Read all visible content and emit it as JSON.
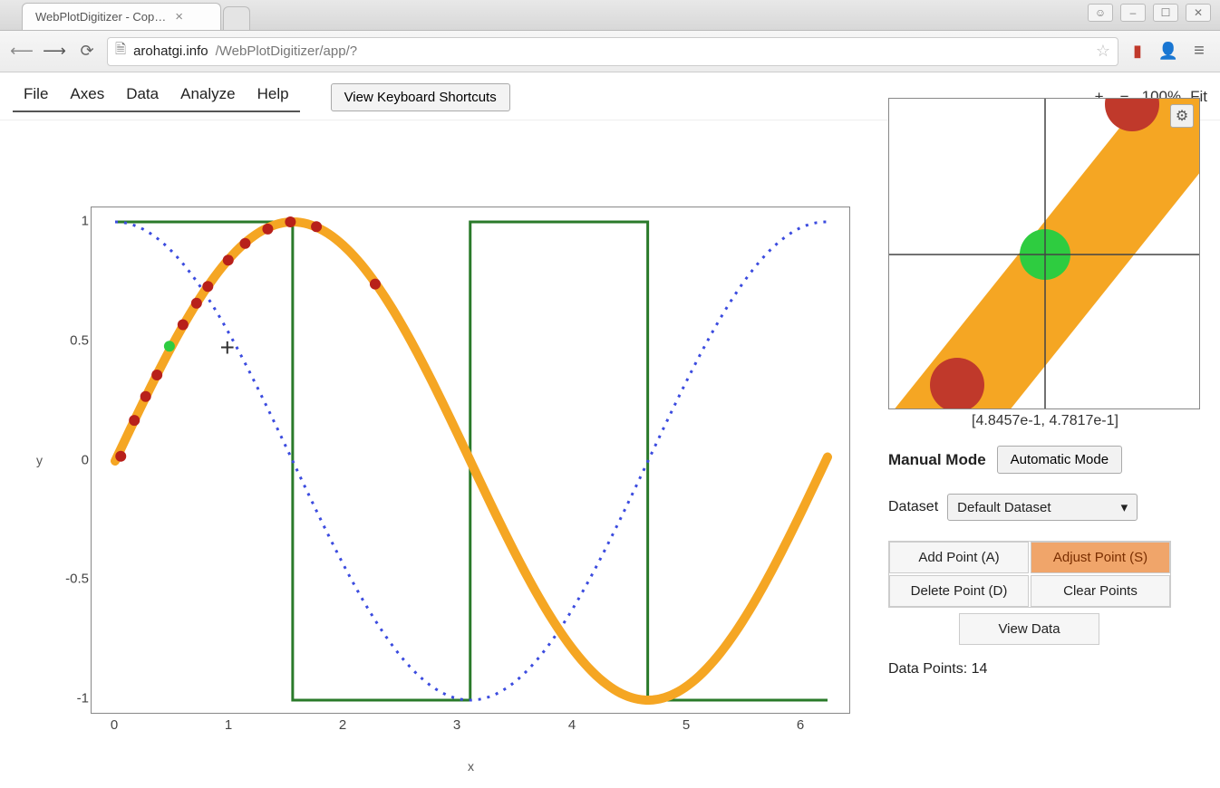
{
  "browser": {
    "tab_title": "WebPlotDigitizer - Cop…",
    "url_host": "arohatgi.info",
    "url_path": "/WebPlotDigitizer/app/?",
    "nav_back_enabled": false,
    "nav_forward_enabled": true
  },
  "menu": {
    "items": [
      "File",
      "Axes",
      "Data",
      "Analyze",
      "Help"
    ],
    "kbd_button": "View Keyboard Shortcuts"
  },
  "zoom": {
    "plus": "+",
    "minus": "−",
    "level": "100%",
    "fit": "Fit"
  },
  "chart_data": {
    "type": "line",
    "xlabel": "x",
    "ylabel": "y",
    "xlim": [
      0,
      6.3
    ],
    "ylim": [
      -1.0,
      1.0
    ],
    "xticks": [
      0,
      1,
      2,
      3,
      4,
      5,
      6
    ],
    "yticks": [
      -1.0,
      -0.5,
      0.0,
      0.5,
      1.0
    ],
    "series": [
      {
        "name": "sine (thick, orange)",
        "x_range": [
          0,
          6.3
        ],
        "fn": "sin(x)",
        "color": "#f5a623"
      },
      {
        "name": "cosine (dotted, blue)",
        "x_range": [
          0,
          6.3
        ],
        "fn": "cos(x)",
        "color": "#3b4bdf"
      },
      {
        "name": "square wave (green)",
        "period": 3.14,
        "low": -1,
        "high": 1,
        "color": "#2a7a2a"
      }
    ],
    "digitized_points": [
      {
        "x": 0.05,
        "y": 0.02
      },
      {
        "x": 0.17,
        "y": 0.17
      },
      {
        "x": 0.27,
        "y": 0.27
      },
      {
        "x": 0.37,
        "y": 0.36
      },
      {
        "x": 0.48,
        "y": 0.48,
        "selected": true
      },
      {
        "x": 0.6,
        "y": 0.57
      },
      {
        "x": 0.72,
        "y": 0.66
      },
      {
        "x": 0.82,
        "y": 0.73
      },
      {
        "x": 1.0,
        "y": 0.84
      },
      {
        "x": 1.15,
        "y": 0.91
      },
      {
        "x": 1.35,
        "y": 0.97
      },
      {
        "x": 1.55,
        "y": 1.0
      },
      {
        "x": 1.78,
        "y": 0.98
      },
      {
        "x": 2.3,
        "y": 0.74
      }
    ],
    "cursor": {
      "x": 1.0,
      "y": 0.47
    }
  },
  "zoom_panel": {
    "coords": "[4.8457e-1, 4.7817e-1]"
  },
  "modes": {
    "active": "Manual Mode",
    "other": "Automatic Mode"
  },
  "dataset": {
    "label": "Dataset",
    "selected": "Default Dataset"
  },
  "buttons": {
    "add": "Add Point (A)",
    "adjust": "Adjust Point (S)",
    "delete": "Delete Point (D)",
    "clear": "Clear Points",
    "view": "View Data"
  },
  "status": {
    "points_label": "Data Points:",
    "points_count": 14
  }
}
